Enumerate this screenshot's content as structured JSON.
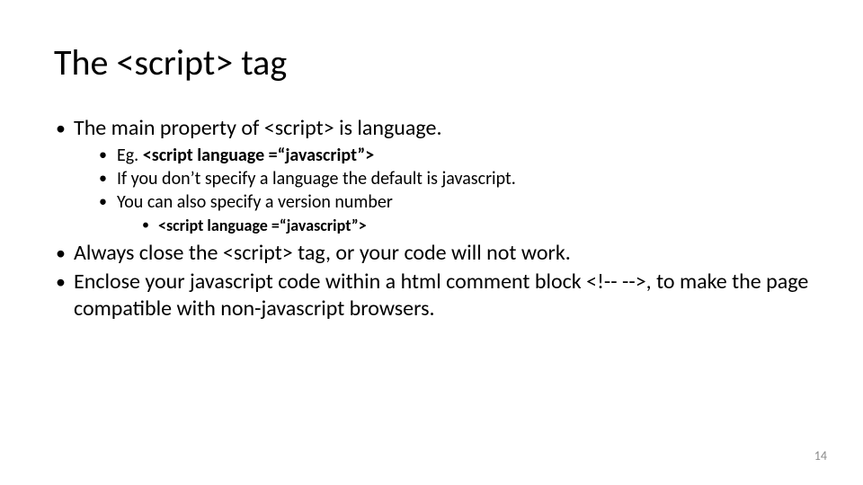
{
  "title": "The <script> tag",
  "bullets": {
    "b1": "The main property of <script> is language.",
    "b1a": "Eg. <script language =“javascript”>",
    "b1b": "If you don’t specify a language the default is javascript.",
    "b1c": "You can also specify a version number",
    "b1c1": "<script language =“javascript”>",
    "b2": "Always close the <script> tag, or your code will not work.",
    "b3": "Enclose your javascript code within a html comment block <!-- -->, to make the page compatible with non-javascript browsers."
  },
  "page_number": "14"
}
